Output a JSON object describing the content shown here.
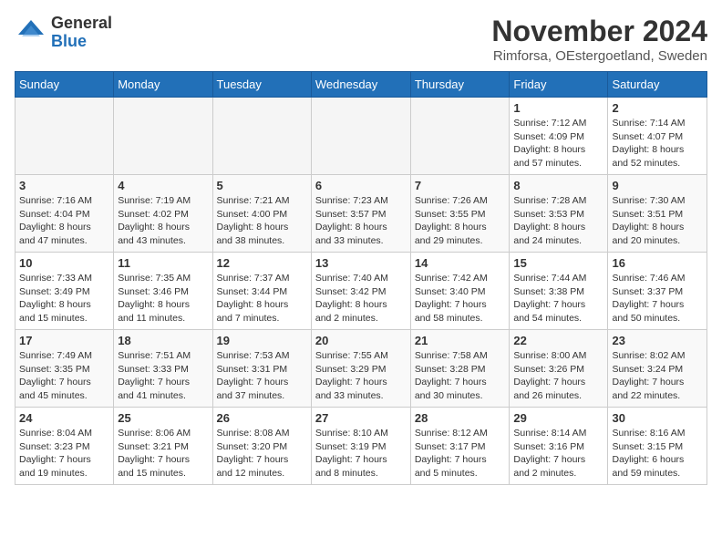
{
  "header": {
    "logo": {
      "general": "General",
      "blue": "Blue"
    },
    "title": "November 2024",
    "location": "Rimforsa, OEstergoetland, Sweden"
  },
  "weekdays": [
    "Sunday",
    "Monday",
    "Tuesday",
    "Wednesday",
    "Thursday",
    "Friday",
    "Saturday"
  ],
  "weeks": [
    [
      {
        "day": "",
        "info": ""
      },
      {
        "day": "",
        "info": ""
      },
      {
        "day": "",
        "info": ""
      },
      {
        "day": "",
        "info": ""
      },
      {
        "day": "",
        "info": ""
      },
      {
        "day": "1",
        "info": "Sunrise: 7:12 AM\nSunset: 4:09 PM\nDaylight: 8 hours\nand 57 minutes."
      },
      {
        "day": "2",
        "info": "Sunrise: 7:14 AM\nSunset: 4:07 PM\nDaylight: 8 hours\nand 52 minutes."
      }
    ],
    [
      {
        "day": "3",
        "info": "Sunrise: 7:16 AM\nSunset: 4:04 PM\nDaylight: 8 hours\nand 47 minutes."
      },
      {
        "day": "4",
        "info": "Sunrise: 7:19 AM\nSunset: 4:02 PM\nDaylight: 8 hours\nand 43 minutes."
      },
      {
        "day": "5",
        "info": "Sunrise: 7:21 AM\nSunset: 4:00 PM\nDaylight: 8 hours\nand 38 minutes."
      },
      {
        "day": "6",
        "info": "Sunrise: 7:23 AM\nSunset: 3:57 PM\nDaylight: 8 hours\nand 33 minutes."
      },
      {
        "day": "7",
        "info": "Sunrise: 7:26 AM\nSunset: 3:55 PM\nDaylight: 8 hours\nand 29 minutes."
      },
      {
        "day": "8",
        "info": "Sunrise: 7:28 AM\nSunset: 3:53 PM\nDaylight: 8 hours\nand 24 minutes."
      },
      {
        "day": "9",
        "info": "Sunrise: 7:30 AM\nSunset: 3:51 PM\nDaylight: 8 hours\nand 20 minutes."
      }
    ],
    [
      {
        "day": "10",
        "info": "Sunrise: 7:33 AM\nSunset: 3:49 PM\nDaylight: 8 hours\nand 15 minutes."
      },
      {
        "day": "11",
        "info": "Sunrise: 7:35 AM\nSunset: 3:46 PM\nDaylight: 8 hours\nand 11 minutes."
      },
      {
        "day": "12",
        "info": "Sunrise: 7:37 AM\nSunset: 3:44 PM\nDaylight: 8 hours\nand 7 minutes."
      },
      {
        "day": "13",
        "info": "Sunrise: 7:40 AM\nSunset: 3:42 PM\nDaylight: 8 hours\nand 2 minutes."
      },
      {
        "day": "14",
        "info": "Sunrise: 7:42 AM\nSunset: 3:40 PM\nDaylight: 7 hours\nand 58 minutes."
      },
      {
        "day": "15",
        "info": "Sunrise: 7:44 AM\nSunset: 3:38 PM\nDaylight: 7 hours\nand 54 minutes."
      },
      {
        "day": "16",
        "info": "Sunrise: 7:46 AM\nSunset: 3:37 PM\nDaylight: 7 hours\nand 50 minutes."
      }
    ],
    [
      {
        "day": "17",
        "info": "Sunrise: 7:49 AM\nSunset: 3:35 PM\nDaylight: 7 hours\nand 45 minutes."
      },
      {
        "day": "18",
        "info": "Sunrise: 7:51 AM\nSunset: 3:33 PM\nDaylight: 7 hours\nand 41 minutes."
      },
      {
        "day": "19",
        "info": "Sunrise: 7:53 AM\nSunset: 3:31 PM\nDaylight: 7 hours\nand 37 minutes."
      },
      {
        "day": "20",
        "info": "Sunrise: 7:55 AM\nSunset: 3:29 PM\nDaylight: 7 hours\nand 33 minutes."
      },
      {
        "day": "21",
        "info": "Sunrise: 7:58 AM\nSunset: 3:28 PM\nDaylight: 7 hours\nand 30 minutes."
      },
      {
        "day": "22",
        "info": "Sunrise: 8:00 AM\nSunset: 3:26 PM\nDaylight: 7 hours\nand 26 minutes."
      },
      {
        "day": "23",
        "info": "Sunrise: 8:02 AM\nSunset: 3:24 PM\nDaylight: 7 hours\nand 22 minutes."
      }
    ],
    [
      {
        "day": "24",
        "info": "Sunrise: 8:04 AM\nSunset: 3:23 PM\nDaylight: 7 hours\nand 19 minutes."
      },
      {
        "day": "25",
        "info": "Sunrise: 8:06 AM\nSunset: 3:21 PM\nDaylight: 7 hours\nand 15 minutes."
      },
      {
        "day": "26",
        "info": "Sunrise: 8:08 AM\nSunset: 3:20 PM\nDaylight: 7 hours\nand 12 minutes."
      },
      {
        "day": "27",
        "info": "Sunrise: 8:10 AM\nSunset: 3:19 PM\nDaylight: 7 hours\nand 8 minutes."
      },
      {
        "day": "28",
        "info": "Sunrise: 8:12 AM\nSunset: 3:17 PM\nDaylight: 7 hours\nand 5 minutes."
      },
      {
        "day": "29",
        "info": "Sunrise: 8:14 AM\nSunset: 3:16 PM\nDaylight: 7 hours\nand 2 minutes."
      },
      {
        "day": "30",
        "info": "Sunrise: 8:16 AM\nSunset: 3:15 PM\nDaylight: 6 hours\nand 59 minutes."
      }
    ]
  ]
}
